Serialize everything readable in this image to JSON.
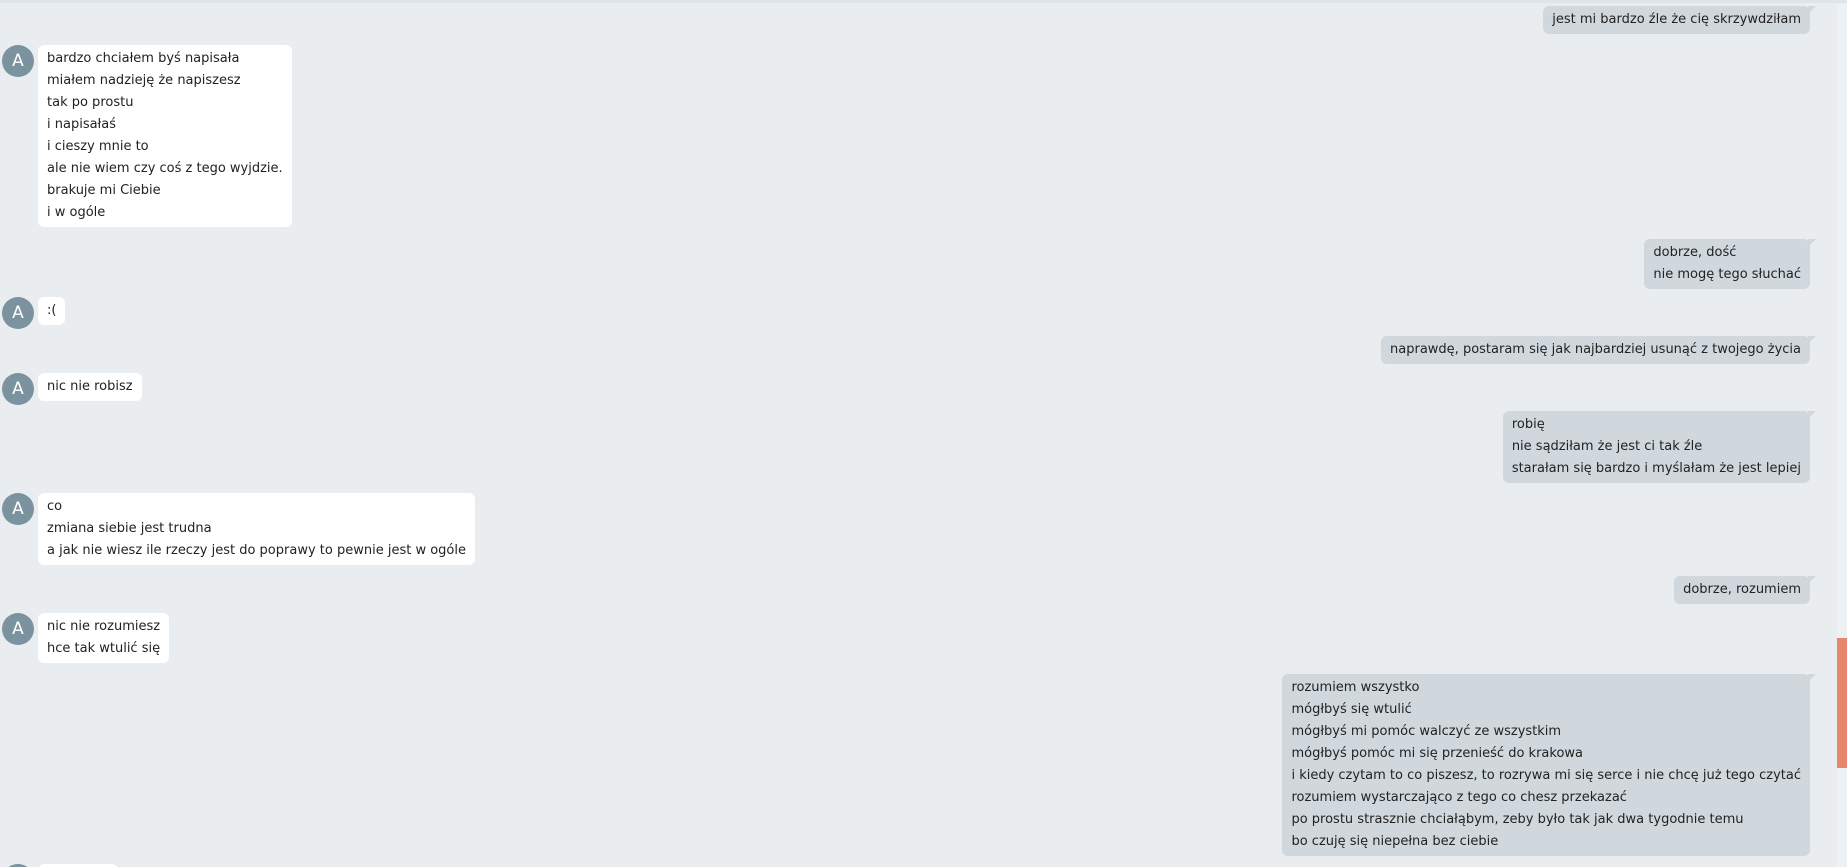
{
  "avatar_letter": "A",
  "colors": {
    "background": "#e9edf0",
    "incoming_bubble": "#ffffff",
    "outgoing_bubble": "#d0d8de",
    "avatar": "#7b929f",
    "scroll_thumb": "#e8866a"
  },
  "messages": [
    {
      "direction": "out",
      "lines": [
        "jest mi bardzo źle że cię skrzywdziłam"
      ]
    },
    {
      "direction": "in",
      "lines": [
        "bardzo chciałem byś napisała",
        "miałem nadzieję że napiszesz",
        "tak po prostu",
        "i napisałaś",
        "i cieszy mnie to",
        "ale nie wiem czy coś z tego wyjdzie.",
        "brakuje mi Ciebie",
        "i w ogóle"
      ]
    },
    {
      "direction": "out",
      "lines": [
        "dobrze, dość",
        "nie mogę tego słuchać"
      ]
    },
    {
      "direction": "in",
      "lines": [
        ":("
      ]
    },
    {
      "direction": "out",
      "lines": [
        "naprawdę, postaram się jak najbardziej usunąć z twojego życia"
      ]
    },
    {
      "direction": "in",
      "lines": [
        "nic nie robisz"
      ]
    },
    {
      "direction": "out",
      "lines": [
        "robię",
        "nie sądziłam że jest ci tak źle",
        "starałam się bardzo i myślałam że jest lepiej"
      ]
    },
    {
      "direction": "in",
      "lines": [
        "co",
        "zmiana siebie jest trudna",
        "a jak nie wiesz ile rzeczy jest do poprawy to pewnie jest w ogóle"
      ]
    },
    {
      "direction": "out",
      "lines": [
        "dobrze, rozumiem"
      ]
    },
    {
      "direction": "in",
      "lines": [
        "nic nie rozumiesz",
        "hce tak wtulić się"
      ]
    },
    {
      "direction": "out",
      "lines": [
        "rozumiem wszystko",
        "mógłbyś się wtulić",
        "mógłbyś mi pomóc walczyć ze wszystkim",
        "mógłbyś pomóc mi się przenieść do krakowa",
        "i kiedy czytam to co piszesz, to rozrywa mi się serce i nie chcę już tego czytać",
        "rozumiem wystarczająco z tego co chesz przekazać",
        "po prostu strasznie chciałąbym, zeby było tak jak dwa tygodnie temu",
        "bo czuję się niepełna bez ciebie"
      ]
    }
  ]
}
